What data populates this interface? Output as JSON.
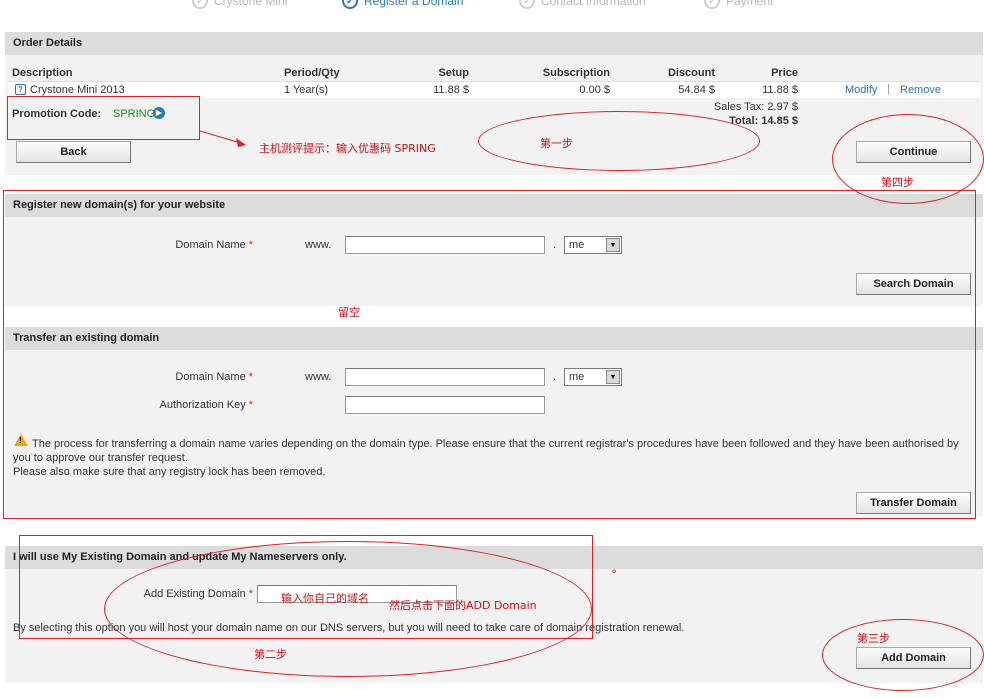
{
  "steps": [
    {
      "label": "Crystone Mini",
      "active": false
    },
    {
      "label": "Register a Domain",
      "active": true
    },
    {
      "label": "Contact Information",
      "active": false
    },
    {
      "label": "Payment",
      "active": false
    }
  ],
  "order": {
    "title": "Order Details",
    "columns": {
      "description": "Description",
      "period": "Period/Qty",
      "setup": "Setup",
      "subscription": "Subscription",
      "discount": "Discount",
      "price": "Price"
    },
    "item": {
      "description": "Crystone Mini 2013",
      "period": "1 Year(s)",
      "setup": "11.88 $",
      "subscription": "0.00 $",
      "discount": "54.84 $",
      "price": "11.88 $",
      "modify": "Modify",
      "remove": "Remove"
    },
    "promo_label": "Promotion Code:",
    "promo_code": "SPRING",
    "sales_tax": "Sales Tax: 2.97 $",
    "total": "Total: 14.85 $",
    "back": "Back",
    "continue": "Continue"
  },
  "register": {
    "title": "Register new domain(s) for your website",
    "domain_label": "Domain Name",
    "www": "www.",
    "dot": ".",
    "tld": "me",
    "search": "Search Domain"
  },
  "transfer": {
    "title": "Transfer an existing domain",
    "domain_label": "Domain Name",
    "www": "www.",
    "dot": ".",
    "tld": "me",
    "auth_label": "Authorization Key",
    "info_line1": "The process for transferring a domain name varies depending on the domain type. Please ensure that the current registrar's procedures have been followed and they have been authorised by",
    "info_line2": "you to approve our transfer request.",
    "info_line3": "Please also make sure that any registry lock has been removed.",
    "button": "Transfer Domain"
  },
  "existing": {
    "title": "I will use My Existing Domain and update My Nameservers only.",
    "label": "Add Existing Domain",
    "info": "By selecting this option you will host your domain name on our DNS servers, but you will need to take care of domain registration renewal.",
    "button": "Add Domain"
  },
  "annotations": {
    "promo_hint": "主机测评提示：输入优惠码 SPRING",
    "step1": "第一步",
    "step4": "第四步",
    "leave_blank": "留空",
    "enter_domain": "输入你自己的域名",
    "then_click": "然后点击下面的ADD Domain",
    "step2": "第二步",
    "step3": "第三步",
    "dot_mark": "。"
  },
  "colors": {
    "annotation": "#d22222",
    "link": "#2a74b5",
    "active_step": "#2a7bbf",
    "promo": "#1a8a1a"
  }
}
